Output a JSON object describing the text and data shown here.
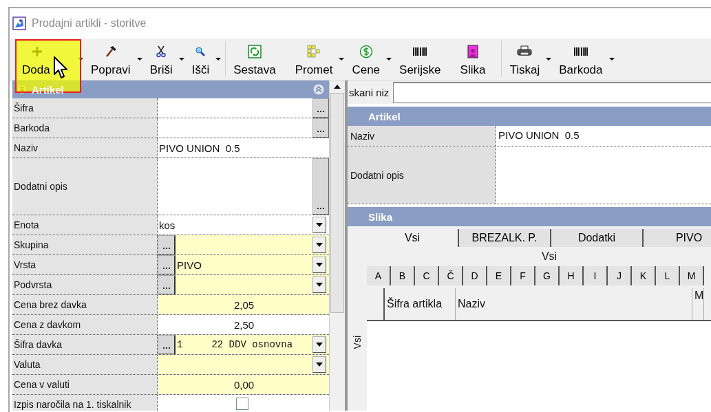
{
  "window": {
    "title": "Prodajni artikli - storitve"
  },
  "toolbar": [
    {
      "label": "Doda",
      "dropdown": true,
      "separator_before": false
    },
    {
      "label": "Popravi",
      "dropdown": true,
      "separator_before": false
    },
    {
      "label": "Briši",
      "dropdown": true,
      "separator_before": false
    },
    {
      "label": "Išči",
      "dropdown": true,
      "separator_before": false
    },
    {
      "label": "Sestava",
      "dropdown": false,
      "separator_before": true
    },
    {
      "label": "Promet",
      "dropdown": true,
      "separator_before": false
    },
    {
      "label": "Cene",
      "dropdown": true,
      "separator_before": false
    },
    {
      "label": "Serijske",
      "dropdown": false,
      "separator_before": false
    },
    {
      "label": "Slika",
      "dropdown": false,
      "separator_before": false
    },
    {
      "label": "Tiskaj",
      "dropdown": true,
      "separator_before": true
    },
    {
      "label": "Barkoda",
      "dropdown": true,
      "separator_before": false
    }
  ],
  "left_panel": {
    "title": "Artikel",
    "rows": [
      {
        "label": "Šifra",
        "kind": "text-button",
        "value": "",
        "highlighted": false
      },
      {
        "label": "Barkoda",
        "kind": "text-button",
        "value": "",
        "highlighted": false
      },
      {
        "label": "Naziv",
        "kind": "text",
        "value": "PIVO UNION  0.5",
        "highlighted": false
      },
      {
        "label": "Dodatni opis",
        "kind": "memo",
        "value": "",
        "highlighted": false
      },
      {
        "label": "Enota",
        "kind": "combo",
        "value": "kos",
        "highlighted": false
      },
      {
        "label": "Skupina",
        "kind": "lookup",
        "value": "",
        "highlighted": true
      },
      {
        "label": "Vrsta",
        "kind": "lookup",
        "value": "PIVO",
        "highlighted": true
      },
      {
        "label": "Podvrsta",
        "kind": "lookup",
        "value": "",
        "highlighted": true
      },
      {
        "label": "Cena brez davka",
        "kind": "number",
        "value": "2,05",
        "highlighted": true
      },
      {
        "label": "Cena z davkom",
        "kind": "number",
        "value": "2,50",
        "highlighted": false
      },
      {
        "label": "Šifra davka",
        "kind": "code-lookup",
        "value": "1     22 DDV osnovna",
        "highlighted": true
      },
      {
        "label": "Valuta",
        "kind": "combo",
        "value": "",
        "highlighted": true
      },
      {
        "label": "Cena v valuti",
        "kind": "number",
        "value": "0,00",
        "highlighted": true
      },
      {
        "label": "Izpis naročila na 1. tiskalnik",
        "kind": "checkbox",
        "checked": false,
        "highlighted": false
      }
    ]
  },
  "search": {
    "label": "skani niz"
  },
  "right_panel": {
    "title": "Artikel",
    "rows": [
      {
        "label": "Naziv",
        "value": "PIVO UNION  0.5"
      },
      {
        "label": "Dodatni opis"
      }
    ]
  },
  "image_section": {
    "title": "Slika",
    "side_tab": "Vsi",
    "tabs": [
      {
        "label": "Vsi",
        "selected": true
      },
      {
        "label": "BREZALK. P.",
        "selected": false
      },
      {
        "label": "Dodatki",
        "selected": false
      },
      {
        "label": "PIVO",
        "selected": false
      }
    ],
    "subtitle": "Vsi",
    "letters": [
      {
        "label": "A",
        "selected": false
      },
      {
        "label": "B",
        "selected": false
      },
      {
        "label": "C",
        "selected": false
      },
      {
        "label": "Č",
        "selected": false
      },
      {
        "label": "D",
        "selected": false
      },
      {
        "label": "E",
        "selected": false
      },
      {
        "label": "F",
        "selected": false
      },
      {
        "label": "G",
        "selected": false
      },
      {
        "label": "H",
        "selected": false
      },
      {
        "label": "I",
        "selected": false
      },
      {
        "label": "J",
        "selected": false
      },
      {
        "label": "K",
        "selected": false
      },
      {
        "label": "L",
        "selected": false
      },
      {
        "label": "M",
        "selected": false
      }
    ],
    "columns": [
      "Šifra artikla",
      "Naziv",
      "M"
    ]
  }
}
